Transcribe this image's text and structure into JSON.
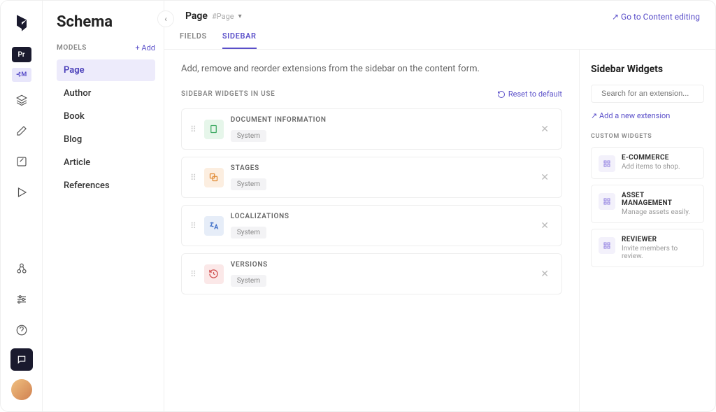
{
  "header": {
    "title": "Schema",
    "page_name": "Page",
    "page_slug": "#Page",
    "goto_link": "↗  Go to Content editing"
  },
  "models": {
    "label": "MODELS",
    "add": "+ Add",
    "items": [
      "Page",
      "Author",
      "Book",
      "Blog",
      "Article",
      "References"
    ]
  },
  "tabs": {
    "fields": "FIELDS",
    "sidebar": "SIDEBAR"
  },
  "editor": {
    "intro": "Add, remove and reorder extensions from the sidebar on the content form.",
    "widgets_in_use_label": "SIDEBAR WIDGETS IN USE",
    "reset_label": "Reset to default"
  },
  "widgets": [
    {
      "title": "DOCUMENT INFORMATION",
      "tag": "System"
    },
    {
      "title": "STAGES",
      "tag": "System"
    },
    {
      "title": "LOCALIZATIONS",
      "tag": "System"
    },
    {
      "title": "VERSIONS",
      "tag": "System"
    }
  ],
  "right": {
    "title": "Sidebar Widgets",
    "search_placeholder": "Search for an extension...",
    "add_new": "↗  Add a new extension",
    "custom_label": "CUSTOM WIDGETS",
    "customs": [
      {
        "title": "E-COMMERCE",
        "desc": "Add items to shop."
      },
      {
        "title": "ASSET MANAGEMENT",
        "desc": "Manage assets easily."
      },
      {
        "title": "REVIEWER",
        "desc": "Invite members to review."
      }
    ]
  }
}
